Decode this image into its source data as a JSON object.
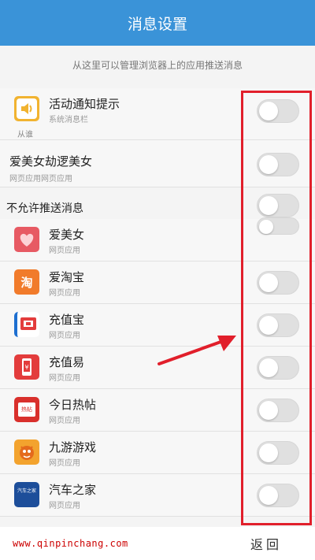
{
  "header": {
    "title": "消息设置"
  },
  "subtitle": "从这里可以管理浏览器上的应用推送消息",
  "allowed": [
    {
      "title": "活动通知提示",
      "sub": "系统消息栏",
      "note": "从谁",
      "icon": "speaker-icon",
      "color": "#f1b330"
    },
    {
      "title": "爱美女劫逻美女",
      "sub": "网页应用网页应用"
    }
  ],
  "section_title": "不允许推送消息",
  "blocked": [
    {
      "title": "爱美女",
      "sub": "网页应用",
      "icon": "heart-icon",
      "color": "#e75a63"
    },
    {
      "title": "爱淘宝",
      "sub": "网页应用",
      "icon": "taobao-icon",
      "color": "#f17b2b"
    },
    {
      "title": "充值宝",
      "sub": "网页应用",
      "icon": "screen-icon",
      "color": "#e33c3c"
    },
    {
      "title": "充值易",
      "sub": "网页应用",
      "icon": "phone-yen-icon",
      "color": "#e33c3c"
    },
    {
      "title": "今日热帖",
      "sub": "网页应用",
      "icon": "redbox-icon",
      "color": "#d9302c"
    },
    {
      "title": "九游游戏",
      "sub": "网页应用",
      "icon": "game-character-icon",
      "color": "#f3a32e"
    },
    {
      "title": "汽车之家",
      "sub": "网页应用",
      "icon": "car-home-icon",
      "color": "#1d4e9a"
    }
  ],
  "icon_texts": {
    "taobao": "淘",
    "hot": "热帖",
    "car": "汽车之家"
  },
  "footer": {
    "url": "www.qinpinchang.com",
    "back": "返回"
  }
}
